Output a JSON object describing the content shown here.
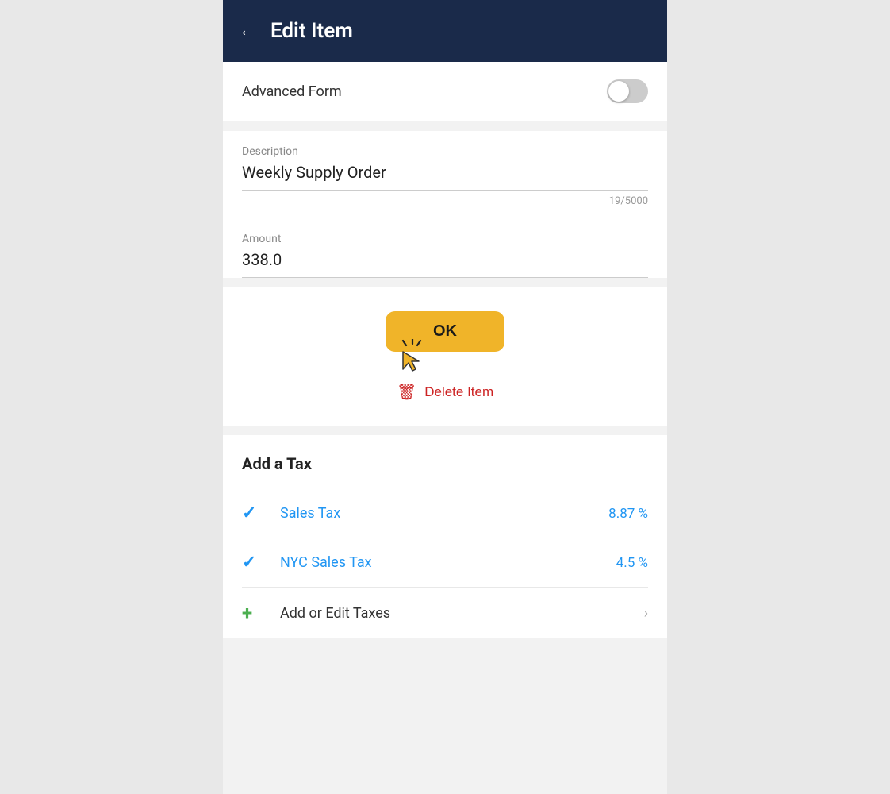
{
  "header": {
    "title": "Edit Item",
    "back_label": "←"
  },
  "advanced_form": {
    "label": "Advanced Form",
    "toggle_on": false
  },
  "description_field": {
    "label": "Description",
    "value": "Weekly Supply Order",
    "char_count": "19/5000"
  },
  "amount_field": {
    "label": "Amount",
    "value": "338.0"
  },
  "actions": {
    "ok_label": "OK",
    "delete_label": "Delete Item"
  },
  "tax_section": {
    "title": "Add a Tax",
    "items": [
      {
        "name": "Sales Tax",
        "rate": "8.87 %",
        "selected": true
      },
      {
        "name": "NYC Sales Tax",
        "rate": "4.5 %",
        "selected": true
      }
    ],
    "add_edit_label": "Add or Edit Taxes"
  }
}
